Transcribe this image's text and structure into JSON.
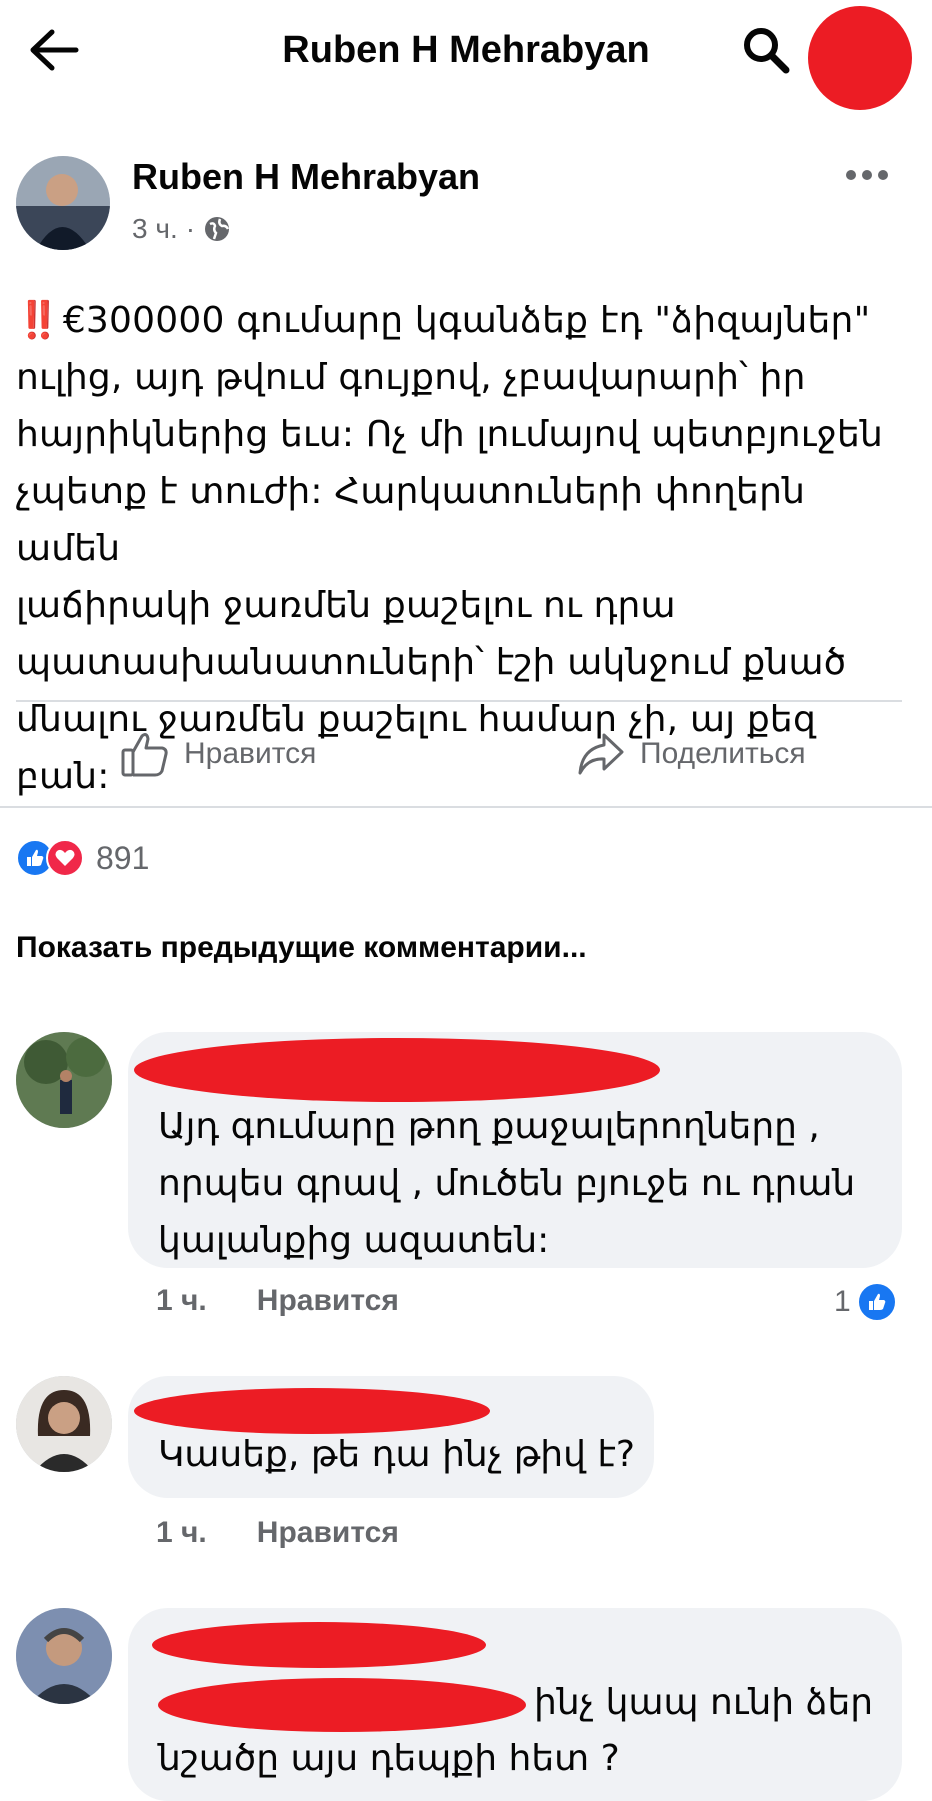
{
  "header": {
    "title": "Ruben H Mehrabyan",
    "back_icon": "arrow-left-icon",
    "search_icon": "search-icon"
  },
  "post": {
    "author": "Ruben H Mehrabyan",
    "time": "3 ч.",
    "separator": "·",
    "privacy_icon": "globe-icon",
    "alert_emoji": "‼️",
    "text": "€300000 գումարը կգանձեք էդ \"ձիզայներ\"\nուլից, այդ թվում գույքով, չբավարարի՝ իր\nհայրիկներից եւս: Ոչ մի լումայով պետբյուջեն\nչպետք է տուժի: Հարկատուների փողերն ամեն\nլաճիրակի ջառմեն քաշելու ու դրա\nպատասխանատուների՝ էշի ակնջում քնած\nմնալու ջառմեն քաշելու համար չի, այ քեզ բան:",
    "like_label": "Нравится",
    "share_label": "Поделиться",
    "reaction_count": "891",
    "accent": "#1877f2",
    "love_color": "#f02849"
  },
  "comments_section": {
    "show_previous": "Показать предыдущие комментарии..."
  },
  "comments": [
    {
      "text": "Այդ գումարը  թող քաջալերողները  ,\nորպես գրավ , մուծեն բյուջե ու  դրան\nկալանքից ազատեն:",
      "time": "1 ч.",
      "like_label": "Нравится",
      "likes": "1"
    },
    {
      "text": "Կասեք, թե դա ինչ թիվ է?",
      "time": "1 ч.",
      "like_label": "Нравится"
    },
    {
      "text_line1": "ինչ կապ ունի ձեր",
      "text_line2": "նշածը այս դեպքի հետ ?"
    }
  ]
}
